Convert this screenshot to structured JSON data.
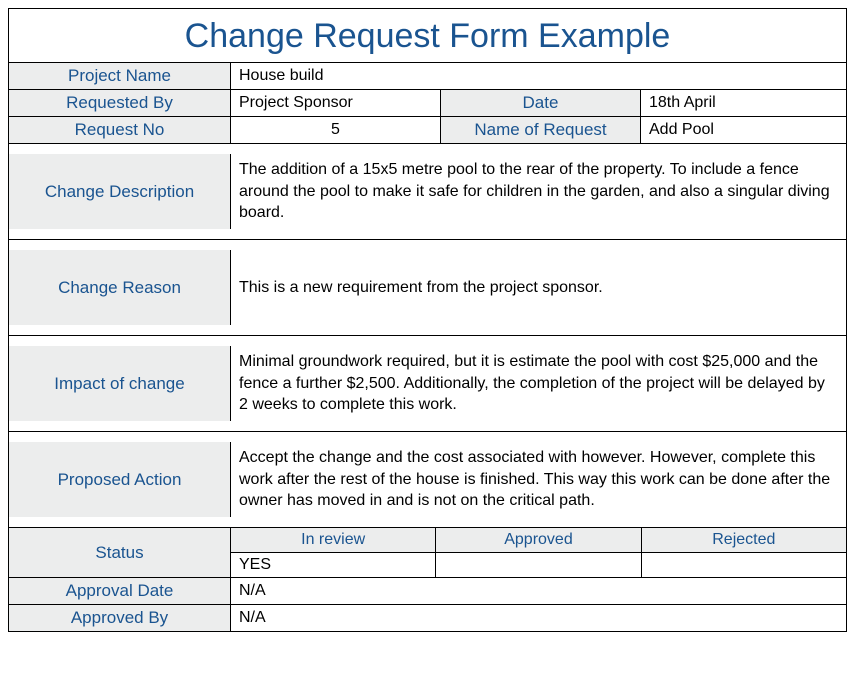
{
  "title": "Change Request Form Example",
  "fields": {
    "project_name_label": "Project Name",
    "project_name_value": "House build",
    "requested_by_label": "Requested By",
    "requested_by_value": "Project Sponsor",
    "date_label": "Date",
    "date_value": "18th April",
    "request_no_label": "Request No",
    "request_no_value": "5",
    "name_of_request_label": "Name of Request",
    "name_of_request_value": "Add Pool",
    "change_description_label": "Change Description",
    "change_description_value": "The addition of a 15x5 metre pool to the rear of the property. To include a fence around the pool to make it safe for children in the garden, and also a singular diving board.",
    "change_reason_label": "Change Reason",
    "change_reason_value": "This is a new requirement from the project sponsor.",
    "impact_label": "Impact of change",
    "impact_value": "Minimal groundwork required, but it is estimate the pool with cost $25,000 and the fence a further $2,500. Additionally, the completion of the project will be delayed by 2 weeks to complete this work.",
    "proposed_action_label": "Proposed Action",
    "proposed_action_value": "Accept the change and the cost associated with however. However, complete this work after the rest of the house is finished. This way this work can be done after the owner has moved in and is not on the critical path.",
    "status_label": "Status",
    "status_options": {
      "in_review": "In review",
      "approved": "Approved",
      "rejected": "Rejected"
    },
    "status_values": {
      "in_review": "YES",
      "approved": "",
      "rejected": ""
    },
    "approval_date_label": "Approval Date",
    "approval_date_value": "N/A",
    "approved_by_label": "Approved By",
    "approved_by_value": "N/A"
  }
}
